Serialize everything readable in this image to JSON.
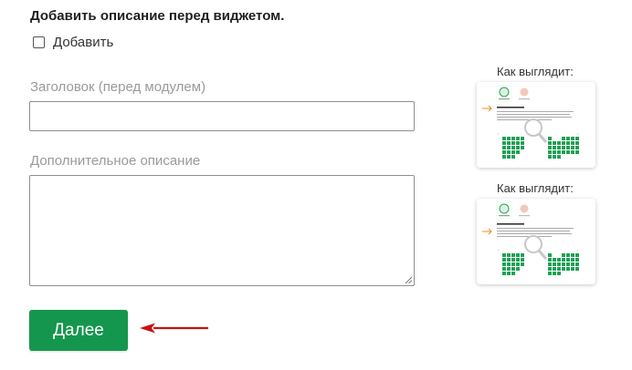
{
  "section": {
    "title": "Добавить описание перед виджетом."
  },
  "add_checkbox": {
    "label": "Добавить",
    "checked": false
  },
  "heading_field": {
    "label": "Заголовок (перед модулем)",
    "value": ""
  },
  "description_field": {
    "label": "Дополнительное описание",
    "value": ""
  },
  "preview": {
    "label_1": "Как выглядит:",
    "label_2": "Как выглядит:"
  },
  "next_button": {
    "label": "Далее"
  },
  "colors": {
    "accent_green": "#15964e",
    "arrow_red": "#cc1111",
    "preview_arrow_orange": "#f08a24"
  }
}
